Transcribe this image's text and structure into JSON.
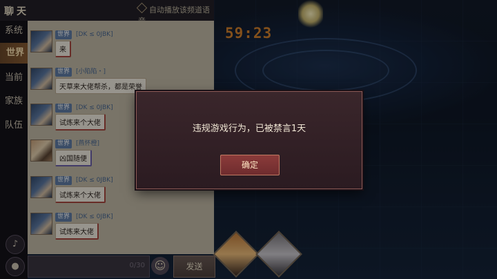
{
  "game": {
    "timer": "59:23"
  },
  "chat": {
    "title": "聊天",
    "auto_play_label": "自动播放该频道语音",
    "tabs": [
      "系统",
      "世界",
      "当前",
      "家族",
      "队伍"
    ],
    "active_tab": "世界",
    "messages": [
      {
        "channel": "世界",
        "username": "[DK ≤ 0JBK]",
        "text": "来",
        "style": "red"
      },
      {
        "channel": "世界",
        "username": "[小陷陷・]",
        "text": "天草来大佬帮杀，都是荣誉",
        "style": "plain"
      },
      {
        "channel": "世界",
        "username": "[DK ≤ 0JBK]",
        "text": "试炼来个大佬",
        "style": "red"
      },
      {
        "channel": "世界",
        "username": "[燕怀橙]",
        "text": "凶国随便",
        "style": "blue"
      },
      {
        "channel": "世界",
        "username": "[DK ≤ 0JBK]",
        "text": "试炼来个大佬",
        "style": "red"
      },
      {
        "channel": "世界",
        "username": "[DK ≤ 0JBK]",
        "text": "试炼来大佬",
        "style": "red"
      }
    ],
    "input": {
      "value": "",
      "counter": "0/30"
    },
    "send_label": "发送"
  },
  "dialog": {
    "message": "违规游戏行为，已被禁言1天",
    "confirm_label": "确定"
  },
  "icons": {
    "speaker": "speaker-icon",
    "microphone": "microphone-icon",
    "emoji": "emoji-icon"
  },
  "colors": {
    "timer": "#d4822d",
    "active_tab": "#8b5e34",
    "dialog_border": "#8d5a56",
    "confirm_button": "#8b3b3a"
  }
}
